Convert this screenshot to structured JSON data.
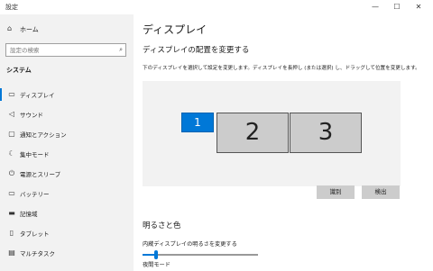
{
  "window": {
    "title": "設定",
    "controls": {
      "minimize": "—",
      "maximize": "☐",
      "close": "✕"
    }
  },
  "sidebar": {
    "home_label": "ホーム",
    "search_placeholder": "設定の検索",
    "section_label": "システム",
    "items": [
      {
        "label": "ディスプレイ",
        "icon": "display-icon",
        "active": true
      },
      {
        "label": "サウンド",
        "icon": "sound-icon",
        "active": false
      },
      {
        "label": "通知とアクション",
        "icon": "notification-icon",
        "active": false
      },
      {
        "label": "集中モード",
        "icon": "focus-moon-icon",
        "active": false
      },
      {
        "label": "電源とスリープ",
        "icon": "power-icon",
        "active": false
      },
      {
        "label": "バッテリー",
        "icon": "battery-icon",
        "active": false
      },
      {
        "label": "記憶域",
        "icon": "storage-icon",
        "active": false
      },
      {
        "label": "タブレット",
        "icon": "tablet-icon",
        "active": false
      },
      {
        "label": "マルチタスク",
        "icon": "multitask-icon",
        "active": false
      }
    ]
  },
  "main": {
    "page_title": "ディスプレイ",
    "arrangement_heading": "ディスプレイの配置を変更する",
    "arrangement_desc": "下のディスプレイを選択して設定を変更します。ディスプレイを長押し (または選択) し、ドラッグして位置を変更します。",
    "monitors": [
      {
        "number": "1",
        "selected": true
      },
      {
        "number": "2",
        "selected": false
      },
      {
        "number": "3",
        "selected": false
      }
    ],
    "identify_button": "識別",
    "detect_button": "検出",
    "brightness_heading": "明るさと色",
    "brightness_label": "内蔵ディスプレイの明るさを変更する",
    "brightness_value": 0.12,
    "night_light_label": "夜間モード"
  },
  "colors": {
    "accent": "#0078d7",
    "sidebar_bg": "#f2f2f2",
    "monitor_bg": "#cccccc"
  }
}
